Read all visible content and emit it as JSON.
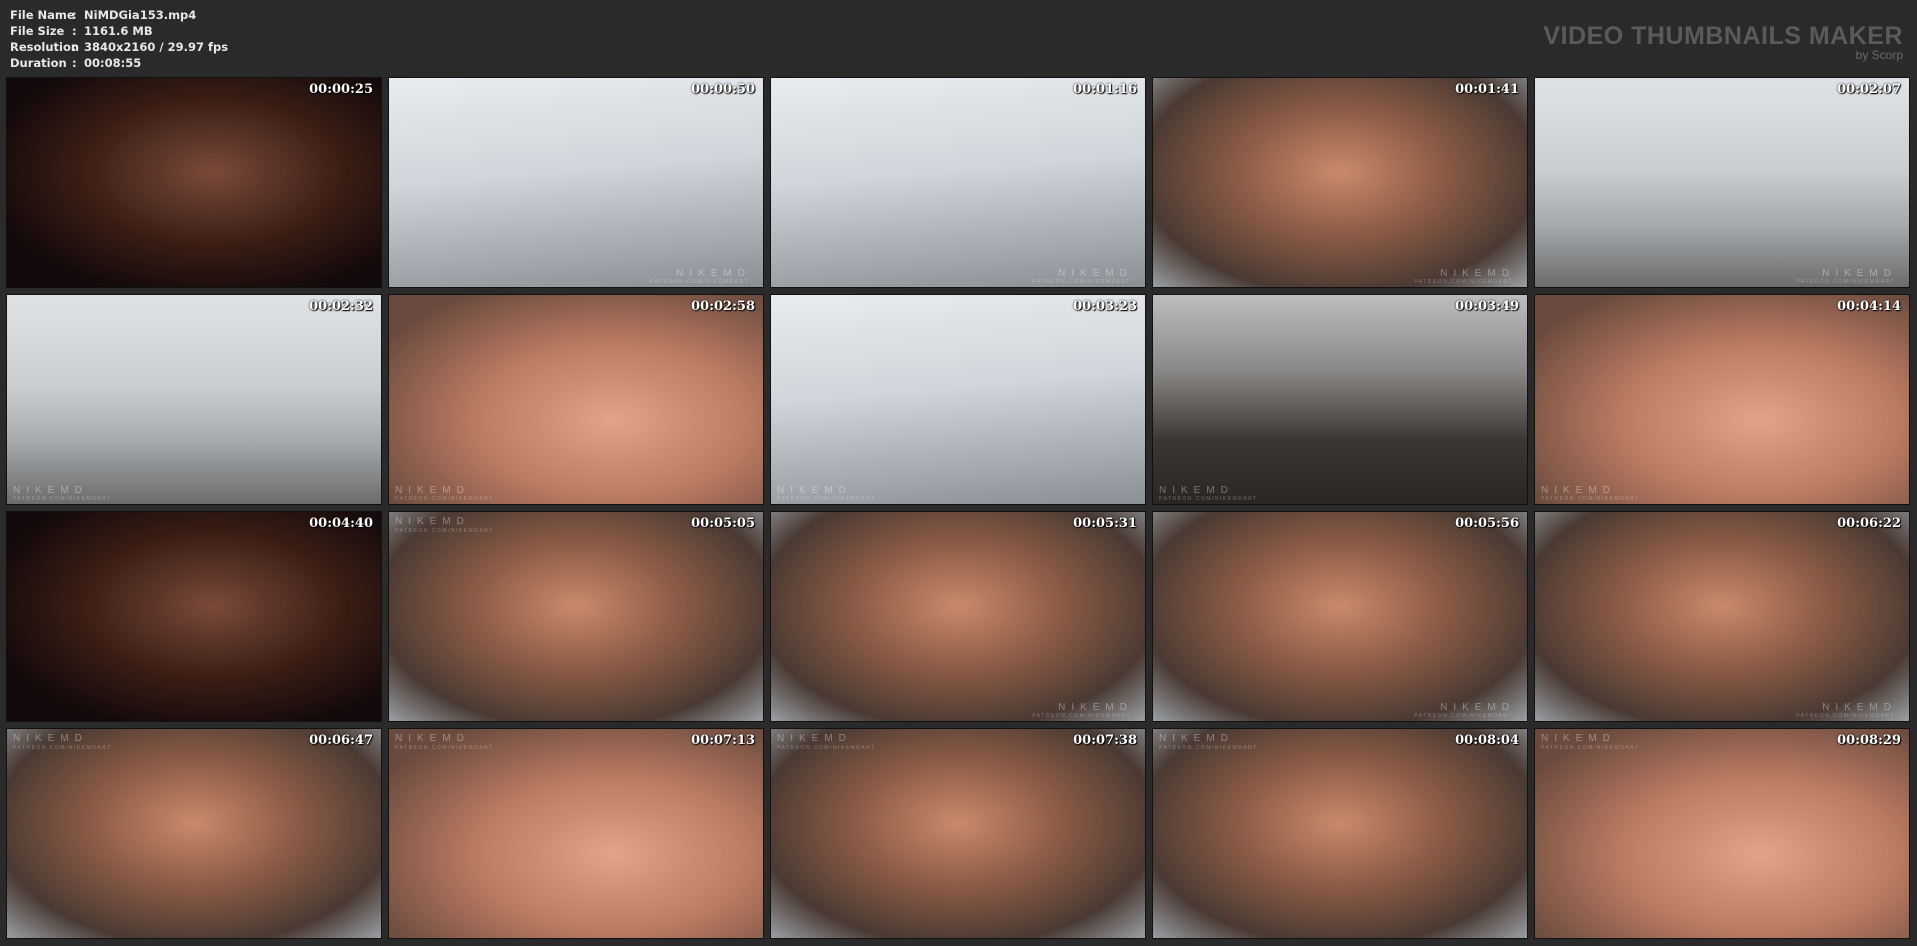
{
  "header": {
    "rows": [
      {
        "key": "File Name",
        "sep": ":",
        "value": "NiMDGia153.mp4"
      },
      {
        "key": "File Size",
        "sep": ":",
        "value": "1161.6 MB"
      },
      {
        "key": "Resolution",
        "sep": ":",
        "value": "3840x2160 / 29.97 fps"
      },
      {
        "key": "Duration",
        "sep": ":",
        "value": "00:08:55"
      }
    ]
  },
  "brand": {
    "title": "VIDEO THUMBNAILS MAKER",
    "subtitle": "by Scorp"
  },
  "watermark": {
    "text": "NIKEMD",
    "sub": "PATREON.COM/NIKEMDART"
  },
  "thumbnails": [
    {
      "time": "00:00:25",
      "scene": "bg-blur"
    },
    {
      "time": "00:00:50",
      "scene": "bg-room"
    },
    {
      "time": "00:01:16",
      "scene": "bg-room"
    },
    {
      "time": "00:01:41",
      "scene": "bg-face"
    },
    {
      "time": "00:02:07",
      "scene": "bg-feet"
    },
    {
      "time": "00:02:32",
      "scene": "bg-feet"
    },
    {
      "time": "00:02:58",
      "scene": "bg-close"
    },
    {
      "time": "00:03:23",
      "scene": "bg-room"
    },
    {
      "time": "00:03:49",
      "scene": "bg-floor"
    },
    {
      "time": "00:04:14",
      "scene": "bg-close"
    },
    {
      "time": "00:04:40",
      "scene": "bg-blur"
    },
    {
      "time": "00:05:05",
      "scene": "bg-face"
    },
    {
      "time": "00:05:31",
      "scene": "bg-face"
    },
    {
      "time": "00:05:56",
      "scene": "bg-face"
    },
    {
      "time": "00:06:22",
      "scene": "bg-face"
    },
    {
      "time": "00:06:47",
      "scene": "bg-face"
    },
    {
      "time": "00:07:13",
      "scene": "bg-close"
    },
    {
      "time": "00:07:38",
      "scene": "bg-face"
    },
    {
      "time": "00:08:04",
      "scene": "bg-face"
    },
    {
      "time": "00:08:29",
      "scene": "bg-close"
    }
  ]
}
